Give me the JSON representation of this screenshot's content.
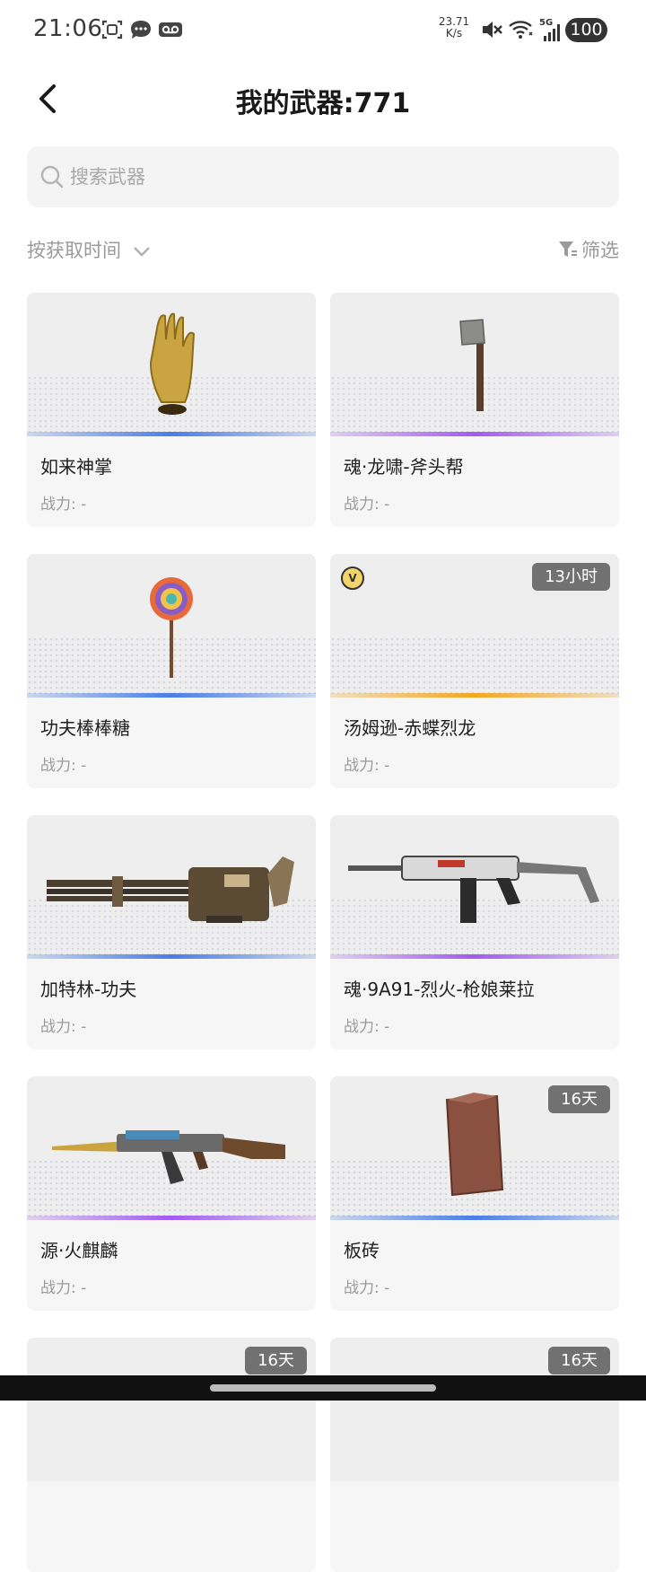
{
  "status_bar": {
    "time": "21:06",
    "net_speed_value": "23.71",
    "net_speed_unit": "K/s",
    "network_type": "5G",
    "battery": "100"
  },
  "header": {
    "title": "我的武器:771"
  },
  "search": {
    "placeholder": "搜索武器"
  },
  "sort": {
    "label": "按获取时间"
  },
  "filter": {
    "label": "筛选"
  },
  "cards": [
    {
      "name": "如来神掌",
      "power": "战力: -",
      "badge": "",
      "rarity_color": "#4a7de8"
    },
    {
      "name": "魂·龙啸-斧头帮",
      "power": "战力: -",
      "badge": "",
      "rarity_color": "#a25bf0"
    },
    {
      "name": "功夫棒棒糖",
      "power": "战力: -",
      "badge": "",
      "rarity_color": "#4a7de8"
    },
    {
      "name": "汤姆逊-赤蝶烈龙",
      "power": "战力: -",
      "badge": "13小时",
      "rarity_color": "#f5a623",
      "vip_label": "V"
    },
    {
      "name": "加特林-功夫",
      "power": "战力: -",
      "badge": "",
      "rarity_color": "#4a7de8"
    },
    {
      "name": "魂·9A91-烈火-枪娘莱拉",
      "power": "战力: -",
      "badge": "",
      "rarity_color": "#a25bf0"
    },
    {
      "name": "源·火麒麟",
      "power": "战力: -",
      "badge": "",
      "rarity_color": "#a25bf0"
    },
    {
      "name": "板砖",
      "power": "战力: -",
      "badge": "16天",
      "rarity_color": "#4a7de8"
    },
    {
      "name": "",
      "power": "",
      "badge": "16天",
      "rarity_color": "#4a7de8"
    },
    {
      "name": "",
      "power": "",
      "badge": "16天",
      "rarity_color": "#4a7de8"
    }
  ]
}
